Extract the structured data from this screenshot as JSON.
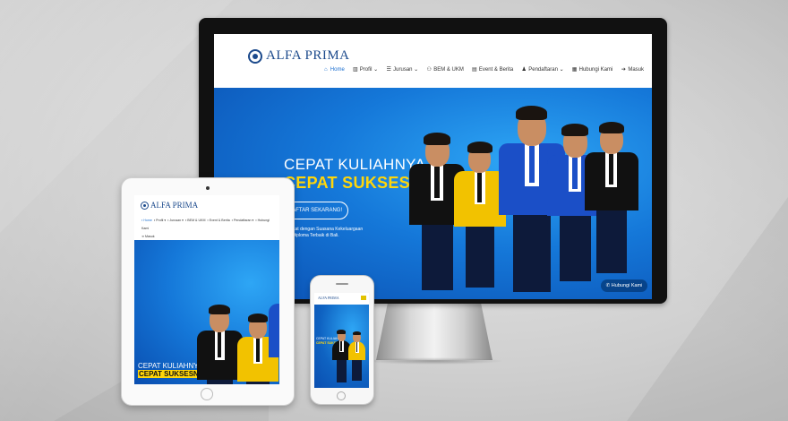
{
  "site": {
    "brand": "ALFA PRIMA",
    "nav": [
      {
        "icon": "home-icon",
        "glyph": "⌂",
        "label": "Home",
        "active": true
      },
      {
        "icon": "bank-icon",
        "glyph": "▥",
        "label": "Profil",
        "caret": "⌄"
      },
      {
        "icon": "list-icon",
        "glyph": "☰",
        "label": "Jurusan",
        "caret": "⌄"
      },
      {
        "icon": "users-icon",
        "glyph": "⚇",
        "label": "BEM & UKM"
      },
      {
        "icon": "calendar-icon",
        "glyph": "▤",
        "label": "Event & Berita"
      },
      {
        "icon": "user-icon",
        "glyph": "♟",
        "label": "Pendaftaran",
        "caret": "⌄"
      },
      {
        "icon": "grid-icon",
        "glyph": "▦",
        "label": "Hubungi Kami"
      },
      {
        "icon": "login-icon",
        "glyph": "➔",
        "label": "Masuk"
      }
    ],
    "hero": {
      "line1": "CEPAT KULIAHNYA,",
      "line2": "CEPAT SUKSESNYA!",
      "cta": "DAFTAR SEKARANG!",
      "desc": "Singkat dengan Suasana Kekeluargaan\npus Diploma Terbaik di Bali."
    },
    "whatsapp_label": "Hubungi Kami"
  },
  "tablet": {
    "nav_line1": [
      "Home",
      "Profil ▾",
      "Jurusan ▾",
      "BEM & UKM",
      "Event & Berita",
      "Pendaftaran ▾",
      "Hubungi Kami"
    ],
    "nav_line2": "Masuk"
  },
  "colors": {
    "brand_blue": "#1c4a8c",
    "hero_blue": "#1578d9",
    "accent_yellow": "#ffd60a"
  }
}
